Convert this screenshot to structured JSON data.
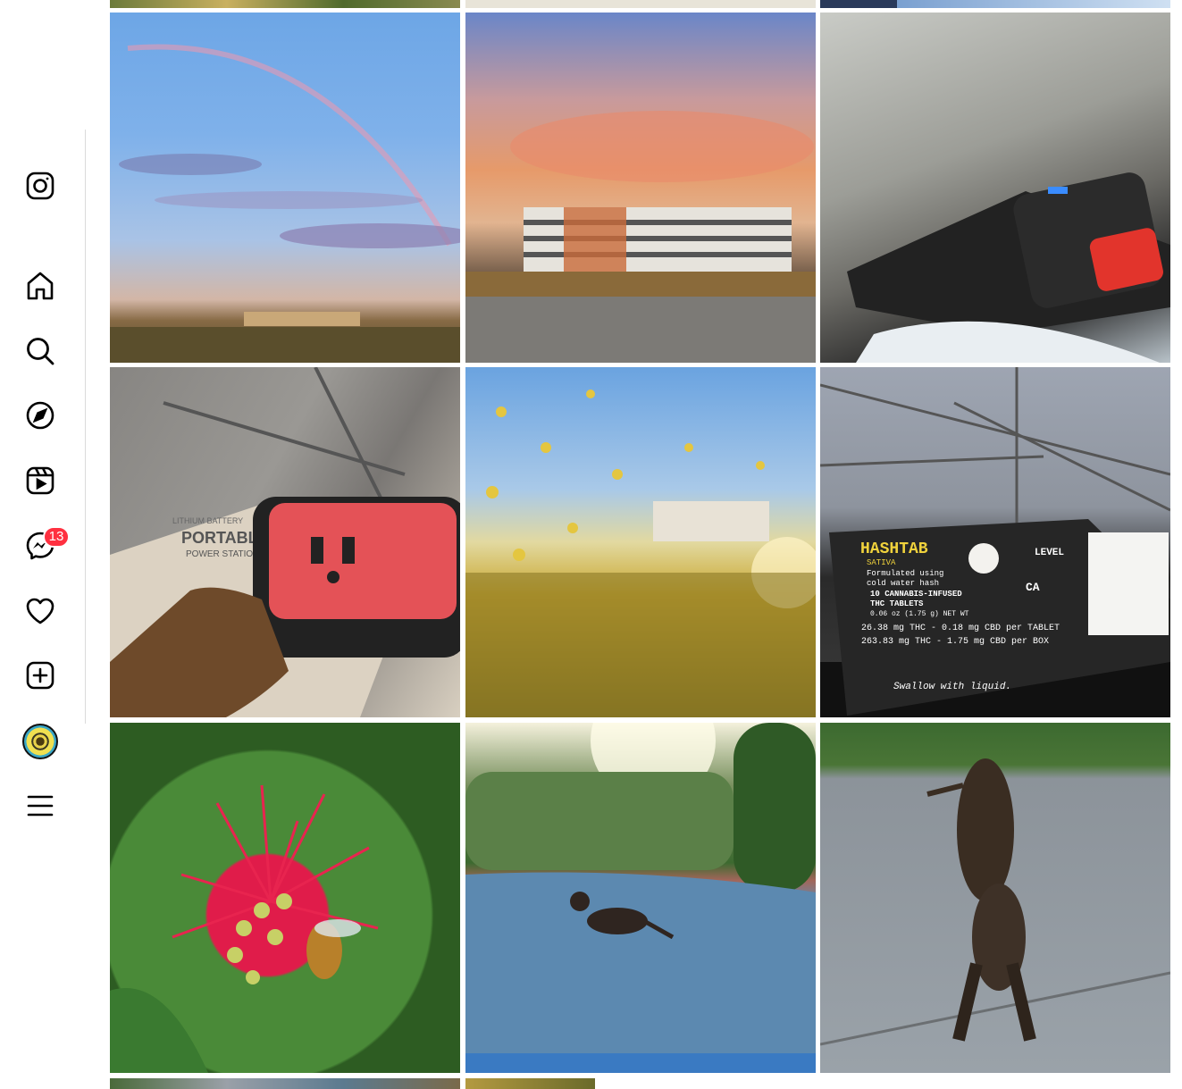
{
  "sidebar": {
    "logo_icon": "instagram-icon",
    "items": [
      {
        "id": "home",
        "icon": "home-icon"
      },
      {
        "id": "search",
        "icon": "search-icon"
      },
      {
        "id": "explore",
        "icon": "compass-icon"
      },
      {
        "id": "reels",
        "icon": "reels-icon"
      },
      {
        "id": "messages",
        "icon": "messenger-icon",
        "badge": "13"
      },
      {
        "id": "notifications",
        "icon": "heart-icon"
      },
      {
        "id": "create",
        "icon": "plus-square-icon"
      },
      {
        "id": "profile",
        "icon": "avatar"
      },
      {
        "id": "more",
        "icon": "menu-icon"
      }
    ]
  },
  "colors": {
    "badge": "#ff3040",
    "divider": "#dbdbdb"
  },
  "grid": {
    "posts": [
      {
        "id": "rainbow",
        "subject": "rainbow over field"
      },
      {
        "id": "sunset-building",
        "subject": "sunset over office building"
      },
      {
        "id": "garage-battery",
        "subject": "battery on laptop in parking garage"
      },
      {
        "id": "portable-power",
        "subject": "portable power station box and outlet",
        "box_text": [
          "LITHIUM BATTERY",
          "PORTABLE",
          "POWER STATION"
        ]
      },
      {
        "id": "yellow-flowers",
        "subject": "yellow mustard flowers"
      },
      {
        "id": "hashtab",
        "subject": "hashtab package by bicycle wheel",
        "package_text": [
          "HASHTAB",
          "SATIVA",
          "Formulated using",
          "cold water hash",
          "10 CANNABIS-INFUSED",
          "THC TABLETS",
          "0.06 oz (1.75 g) NET WT",
          "26.38 mg THC - 0.18 mg CBD per TABLET",
          "263.83 mg THC - 1.75 mg CBD per BOX",
          "Swallow with liquid.",
          "LEVEL",
          "CA"
        ]
      },
      {
        "id": "bee-flower",
        "subject": "bee on red bottlebrush flower"
      },
      {
        "id": "cat-walking",
        "subject": "cat walking on path"
      },
      {
        "id": "cat-stretching",
        "subject": "cat stretching on sidewalk"
      }
    ]
  }
}
